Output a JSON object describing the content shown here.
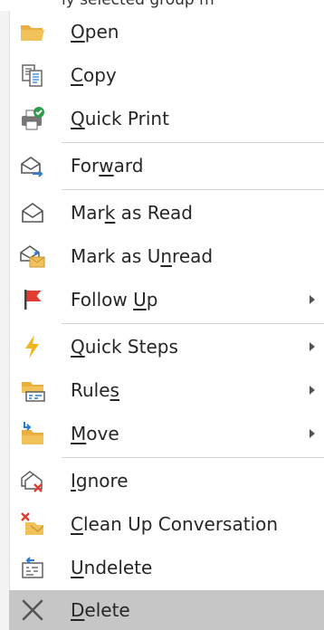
{
  "header_fragment": "ly selected group m",
  "menu": {
    "items": [
      {
        "pre": "",
        "key": "O",
        "post": "pen",
        "icon": "folder-open-icon",
        "submenu": false
      },
      {
        "pre": "",
        "key": "C",
        "post": "opy",
        "icon": "copy-icon",
        "submenu": false
      },
      {
        "pre": "",
        "key": "Q",
        "post": "uick Print",
        "icon": "quick-print-icon",
        "submenu": false
      },
      {
        "pre": "For",
        "key": "w",
        "post": "ard",
        "icon": "forward-icon",
        "submenu": false
      },
      {
        "pre": "Mar",
        "key": "k",
        "post": " as Read",
        "icon": "envelope-open-icon",
        "submenu": false
      },
      {
        "pre": "Mark as U",
        "key": "n",
        "post": "read",
        "icon": "envelope-unread-icon",
        "submenu": false
      },
      {
        "pre": "Follow ",
        "key": "U",
        "post": "p",
        "icon": "flag-icon",
        "submenu": true
      },
      {
        "pre": "",
        "key": "Q",
        "post": "uick Steps",
        "icon": "lightning-icon",
        "submenu": true
      },
      {
        "pre": "Rule",
        "key": "s",
        "post": "",
        "icon": "rules-icon",
        "submenu": true
      },
      {
        "pre": "",
        "key": "M",
        "post": "ove",
        "icon": "move-folder-icon",
        "submenu": true
      },
      {
        "pre": "",
        "key": "I",
        "post": "gnore",
        "icon": "ignore-icon",
        "submenu": false
      },
      {
        "pre": "",
        "key": "C",
        "post": "lean Up Conversation",
        "icon": "clean-up-icon",
        "submenu": false
      },
      {
        "pre": "",
        "key": "U",
        "post": "ndelete",
        "icon": "undelete-icon",
        "submenu": false
      },
      {
        "pre": "",
        "key": "D",
        "post": "elete",
        "icon": "delete-x-icon",
        "submenu": false
      }
    ]
  },
  "colors": {
    "highlight": "#c6c6c6",
    "folder": "#f2c25a",
    "flag": "#e03c31",
    "lightning": "#f2b51c",
    "check": "#2e9b4a",
    "arrow_blue": "#2a7ad6",
    "delete_x": "#555555"
  }
}
